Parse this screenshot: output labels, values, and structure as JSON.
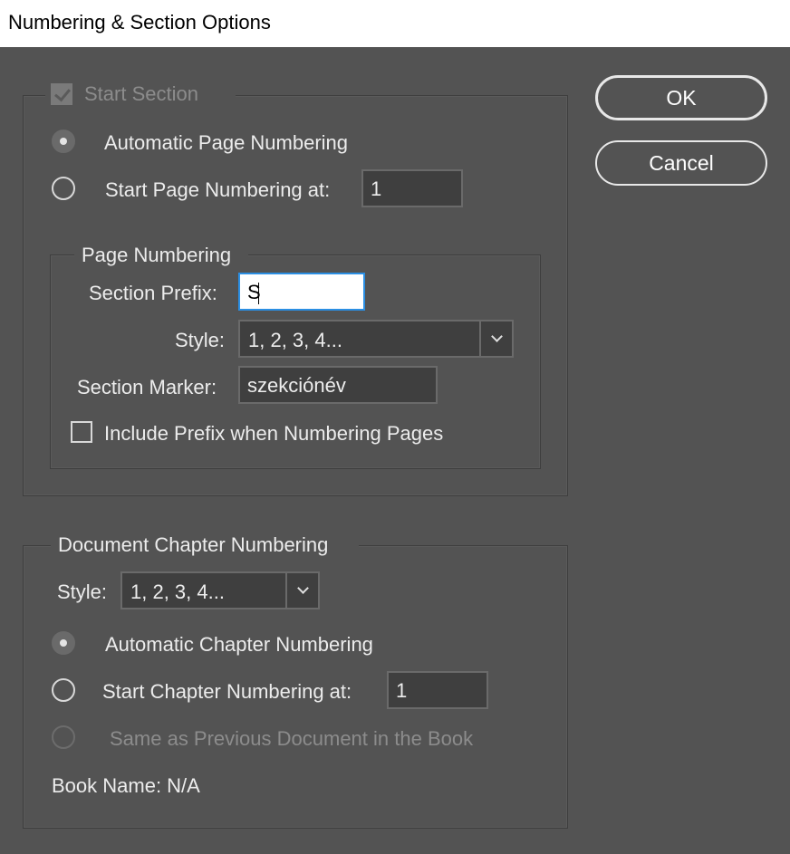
{
  "window": {
    "title": "Numbering & Section Options"
  },
  "buttons": {
    "ok": "OK",
    "cancel": "Cancel"
  },
  "section": {
    "start_section_label": "Start Section",
    "start_section_checked": true,
    "auto_page_label": "Automatic Page Numbering",
    "start_page_label": "Start Page Numbering at:",
    "start_page_value": "1",
    "page_numbering": {
      "legend": "Page Numbering",
      "prefix_label": "Section Prefix:",
      "prefix_value": "S",
      "style_label": "Style:",
      "style_value": "1, 2, 3, 4...",
      "marker_label": "Section Marker:",
      "marker_value": "szekciónév",
      "include_prefix_label": "Include Prefix when Numbering Pages"
    }
  },
  "chapter": {
    "legend": "Document Chapter Numbering",
    "style_label": "Style:",
    "style_value": "1, 2, 3, 4...",
    "auto_label": "Automatic Chapter Numbering",
    "start_label": "Start Chapter Numbering at:",
    "start_value": "1",
    "same_as_prev_label": "Same as Previous Document in the Book",
    "book_name_label": "Book Name: N/A"
  }
}
